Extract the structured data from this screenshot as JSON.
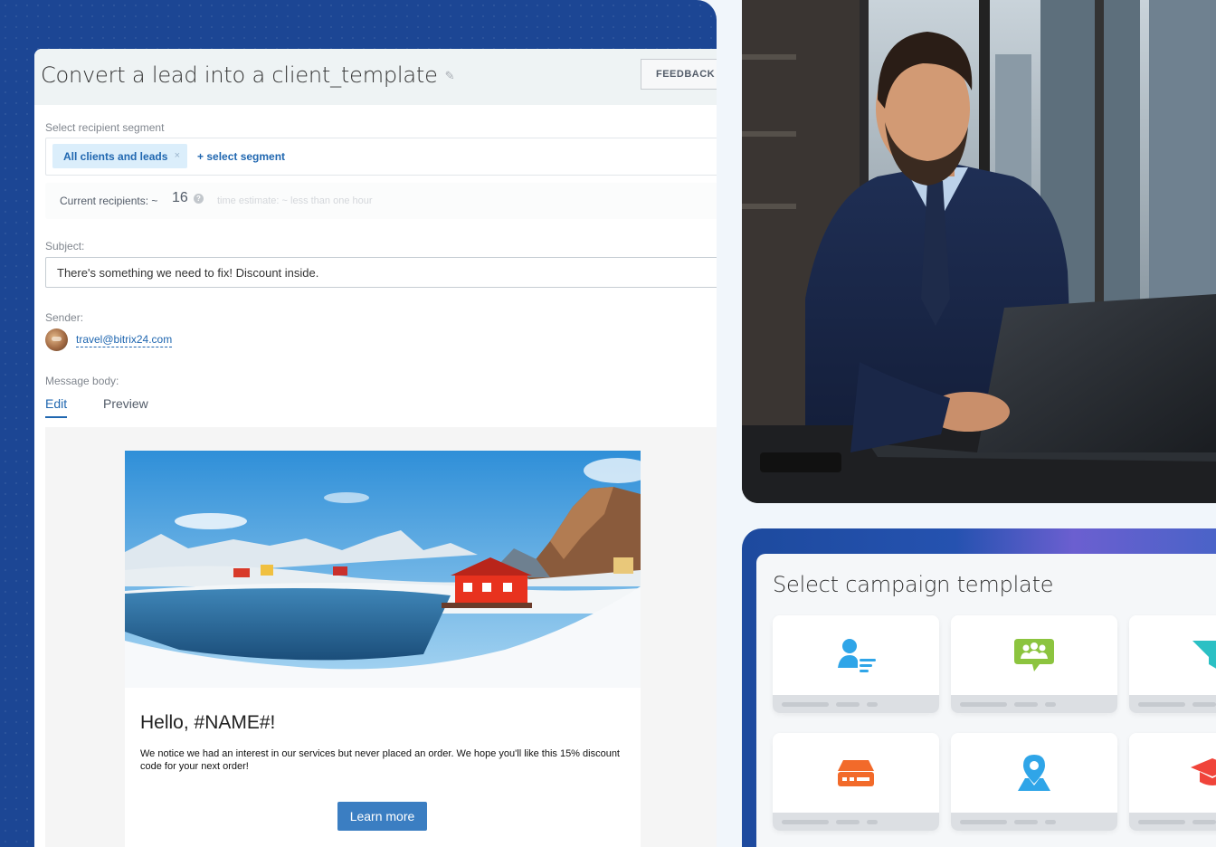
{
  "editor": {
    "title": "Convert a lead into a client_template",
    "feedback_label": "FEEDBACK FORM",
    "segment": {
      "label": "Select recipient segment",
      "selected_tag": "All clients and leads",
      "remove_glyph": "×",
      "add_label": "+ select segment"
    },
    "recipients": {
      "label": "Current recipients: ~",
      "count": "16",
      "help_glyph": "?",
      "estimate": "time estimate: ~ less than one hour"
    },
    "subject": {
      "label": "Subject:",
      "value": "There's something we need to fix! Discount inside."
    },
    "sender": {
      "label": "Sender:",
      "email": "travel@bitrix24.com"
    },
    "body": {
      "label": "Message body:",
      "tabs": [
        "Edit",
        "Preview"
      ],
      "active_tab": "Edit"
    },
    "email_preview": {
      "greeting": "Hello, #NAME#!",
      "text": "We notice we had an interest in our services but never placed an order. We hope you'll like this 15% discount code for your next order!",
      "button_label": "Learn more"
    }
  },
  "templates": {
    "title": "Select campaign template",
    "tiles": [
      {
        "icon": "user-list-icon",
        "color": "#2fa5e8"
      },
      {
        "icon": "group-chat-icon",
        "color": "#8cc43f"
      },
      {
        "icon": "funnel-check-icon",
        "color": "#2bc0c4"
      },
      {
        "icon": "inbox-tray-icon",
        "color": "#f26a2a"
      },
      {
        "icon": "location-pin-icon",
        "color": "#2fa5e8"
      },
      {
        "icon": "graduation-cap-icon",
        "color": "#f0443a"
      }
    ]
  },
  "colors": {
    "brand_blue": "#1c4694",
    "link": "#2067b0",
    "button": "#3b7ec2"
  }
}
